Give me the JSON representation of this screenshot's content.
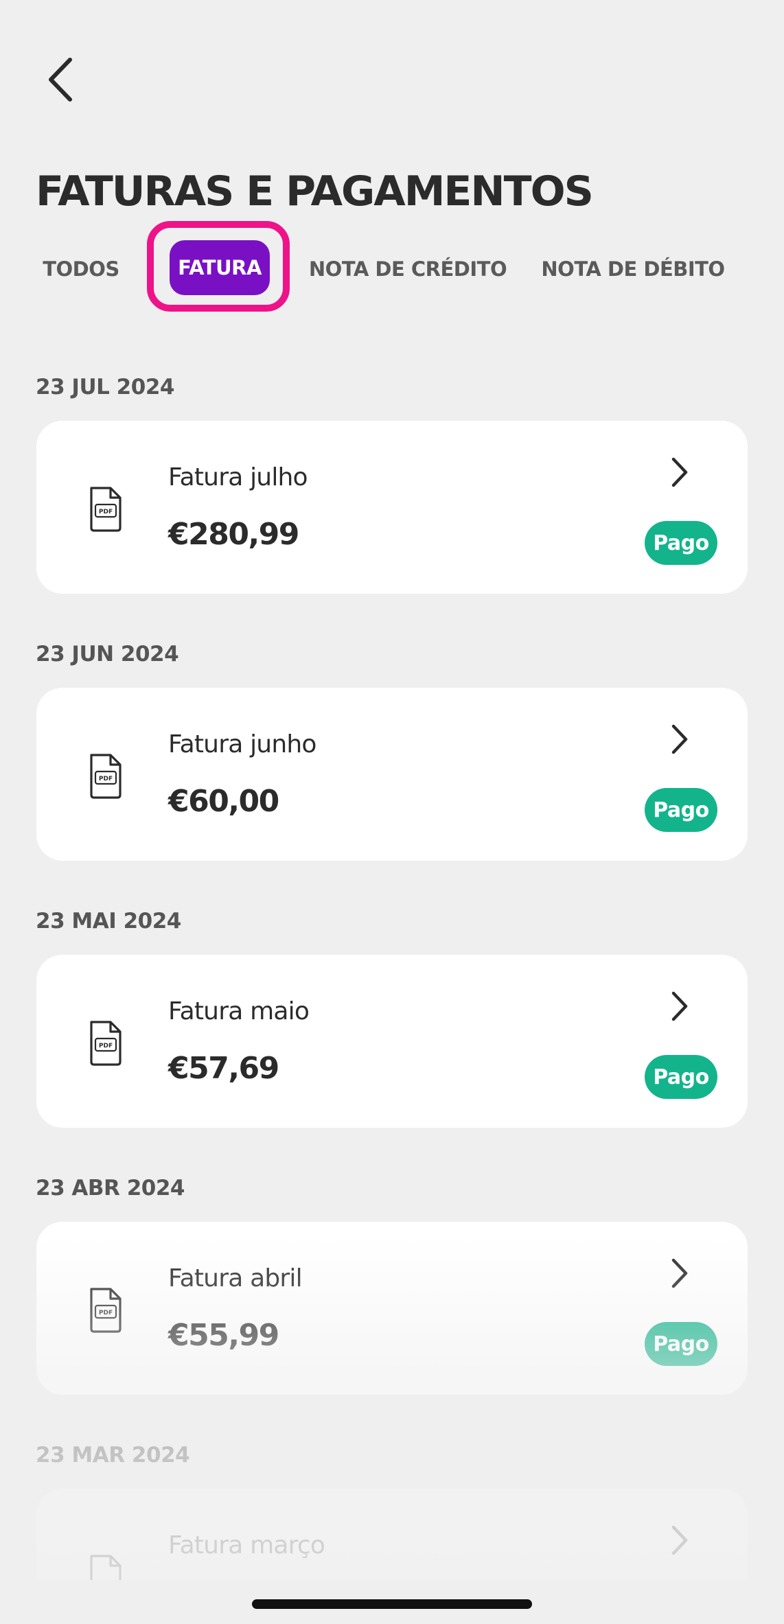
{
  "header": {
    "title": "FATURAS E PAGAMENTOS",
    "back_icon": "chevron-left-icon"
  },
  "tabs": [
    {
      "label": "TODOS",
      "active": false
    },
    {
      "label": "FATURA",
      "active": true
    },
    {
      "label": "NOTA DE CRÉDITO",
      "active": false
    },
    {
      "label": "NOTA DE DÉBITO",
      "active": false
    }
  ],
  "colors": {
    "active_tab": "#7a10c4",
    "highlight_border": "#ee1388",
    "paid_badge": "#13b48c",
    "background": "#efefef"
  },
  "invoices": [
    {
      "date": "23 JUL 2024",
      "name": "Fatura julho",
      "amount": "€280,99",
      "status": "Pago"
    },
    {
      "date": "23 JUN 2024",
      "name": "Fatura junho",
      "amount": "€60,00",
      "status": "Pago"
    },
    {
      "date": "23 MAI 2024",
      "name": "Fatura maio",
      "amount": "€57,69",
      "status": "Pago"
    },
    {
      "date": "23 ABR 2024",
      "name": "Fatura abril",
      "amount": "€55,99",
      "status": "Pago"
    },
    {
      "date": "23 MAR 2024",
      "name": "Fatura março",
      "amount": "",
      "status": ""
    }
  ],
  "icons": {
    "document": "pdf-file-icon",
    "row_chevron": "chevron-right-icon"
  }
}
